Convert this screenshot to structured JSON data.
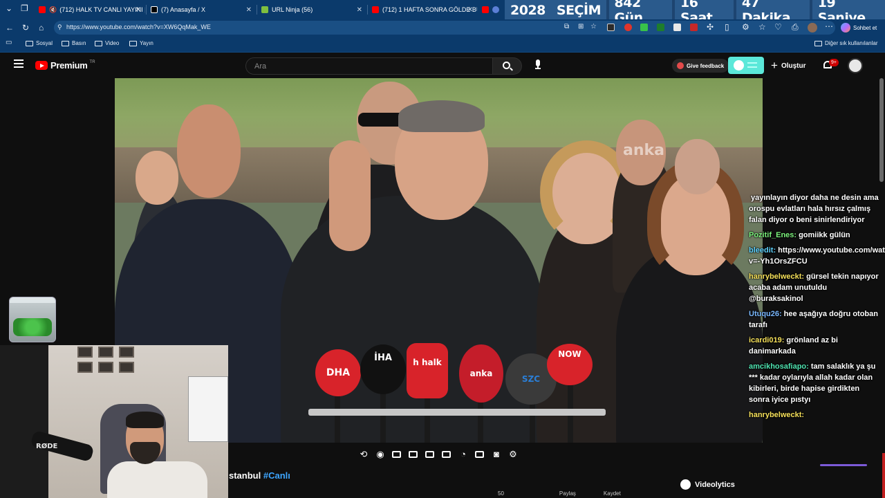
{
  "browser": {
    "tabs": [
      {
        "title": "(712) HALK TV CANLI YAYINI |",
        "favicon_color": "#ff0000"
      },
      {
        "title": "(7) Anasayfa / X",
        "favicon_color": "#000000"
      },
      {
        "title": "URL Ninja (56)",
        "favicon_color": "#7fbf3f"
      },
      {
        "title": "(712) 1 HAFTA SONRA GÖLDE BU",
        "favicon_color": "#ff0000"
      }
    ],
    "address": "https://www.youtube.com/watch?v=XW6QqMak_WE",
    "chat_label": "Sohbet et",
    "bookmarks": [
      "Sosyal",
      "Basın",
      "Video",
      "Yayın"
    ],
    "other_bookmarks": "Diğer sık kullanılanlar"
  },
  "countdown": {
    "year": "2028",
    "label": "SEÇİM",
    "days": "842 Gün",
    "hours": "16 Saat",
    "minutes": "47 Dakika",
    "seconds": "19 Saniye"
  },
  "youtube": {
    "brand": "Premium",
    "region": "TR",
    "search_placeholder": "Ara",
    "feedback_label": "Give feedback",
    "create_label": "Oluştur",
    "notif_badge": "9+",
    "video_watermark": "anka",
    "title_fragment": "stanbul",
    "title_hashtag": "#Canlı",
    "videolytics_label": "Videolytics",
    "actions": [
      "50",
      "",
      "Paylaş",
      "Kaydet"
    ]
  },
  "microphones": [
    {
      "label": "DHA",
      "color": "#d8232a"
    },
    {
      "label": "İHA",
      "color": "#111111"
    },
    {
      "label": "h halk",
      "color": "#d8232a"
    },
    {
      "label": "anka",
      "color": "#c41d2a"
    },
    {
      "label": "SZC",
      "color": "#444444"
    },
    {
      "label": "NOW",
      "color": "#d8232a"
    }
  ],
  "chat": [
    {
      "user": "",
      "text": "yayınlayın diyor daha ne desin ama orospu evlatları hala hırsız çalmış falan diyor o beni sinirlendiriyor",
      "color": "#ffffff"
    },
    {
      "user": "Pozitif_Enes:",
      "text": "gomiikk gülün",
      "color": "#7cf27c"
    },
    {
      "user": "bleedit:",
      "text": "https://www.youtube.com/watch?v=-Yh1OrsZFCU",
      "color": "#5fd3ff"
    },
    {
      "user": "hanrybelweckt:",
      "text": "gürsel tekin napıyor acaba adam unutuldu @buraksakinol",
      "color": "#f5e05a"
    },
    {
      "user": "Utuqu26:",
      "text": "hee aşağıya doğru otoban tarafı",
      "color": "#7ab8ff"
    },
    {
      "user": "icardi019:",
      "text": "grönland az bi danimarkada",
      "color": "#f5e05a"
    },
    {
      "user": "amcikhosafiapo:",
      "text": "tam salaklık ya şu *** kadar oylarıyla allah kadar olan kibirleri, birde hapise girdikten sonra iyice pıstyı",
      "color": "#4fe3b0"
    },
    {
      "user": "hanrybelweckt:",
      "text": "",
      "color": "#f5e05a"
    }
  ],
  "webcam": {
    "mic_brand": "RØDE"
  }
}
